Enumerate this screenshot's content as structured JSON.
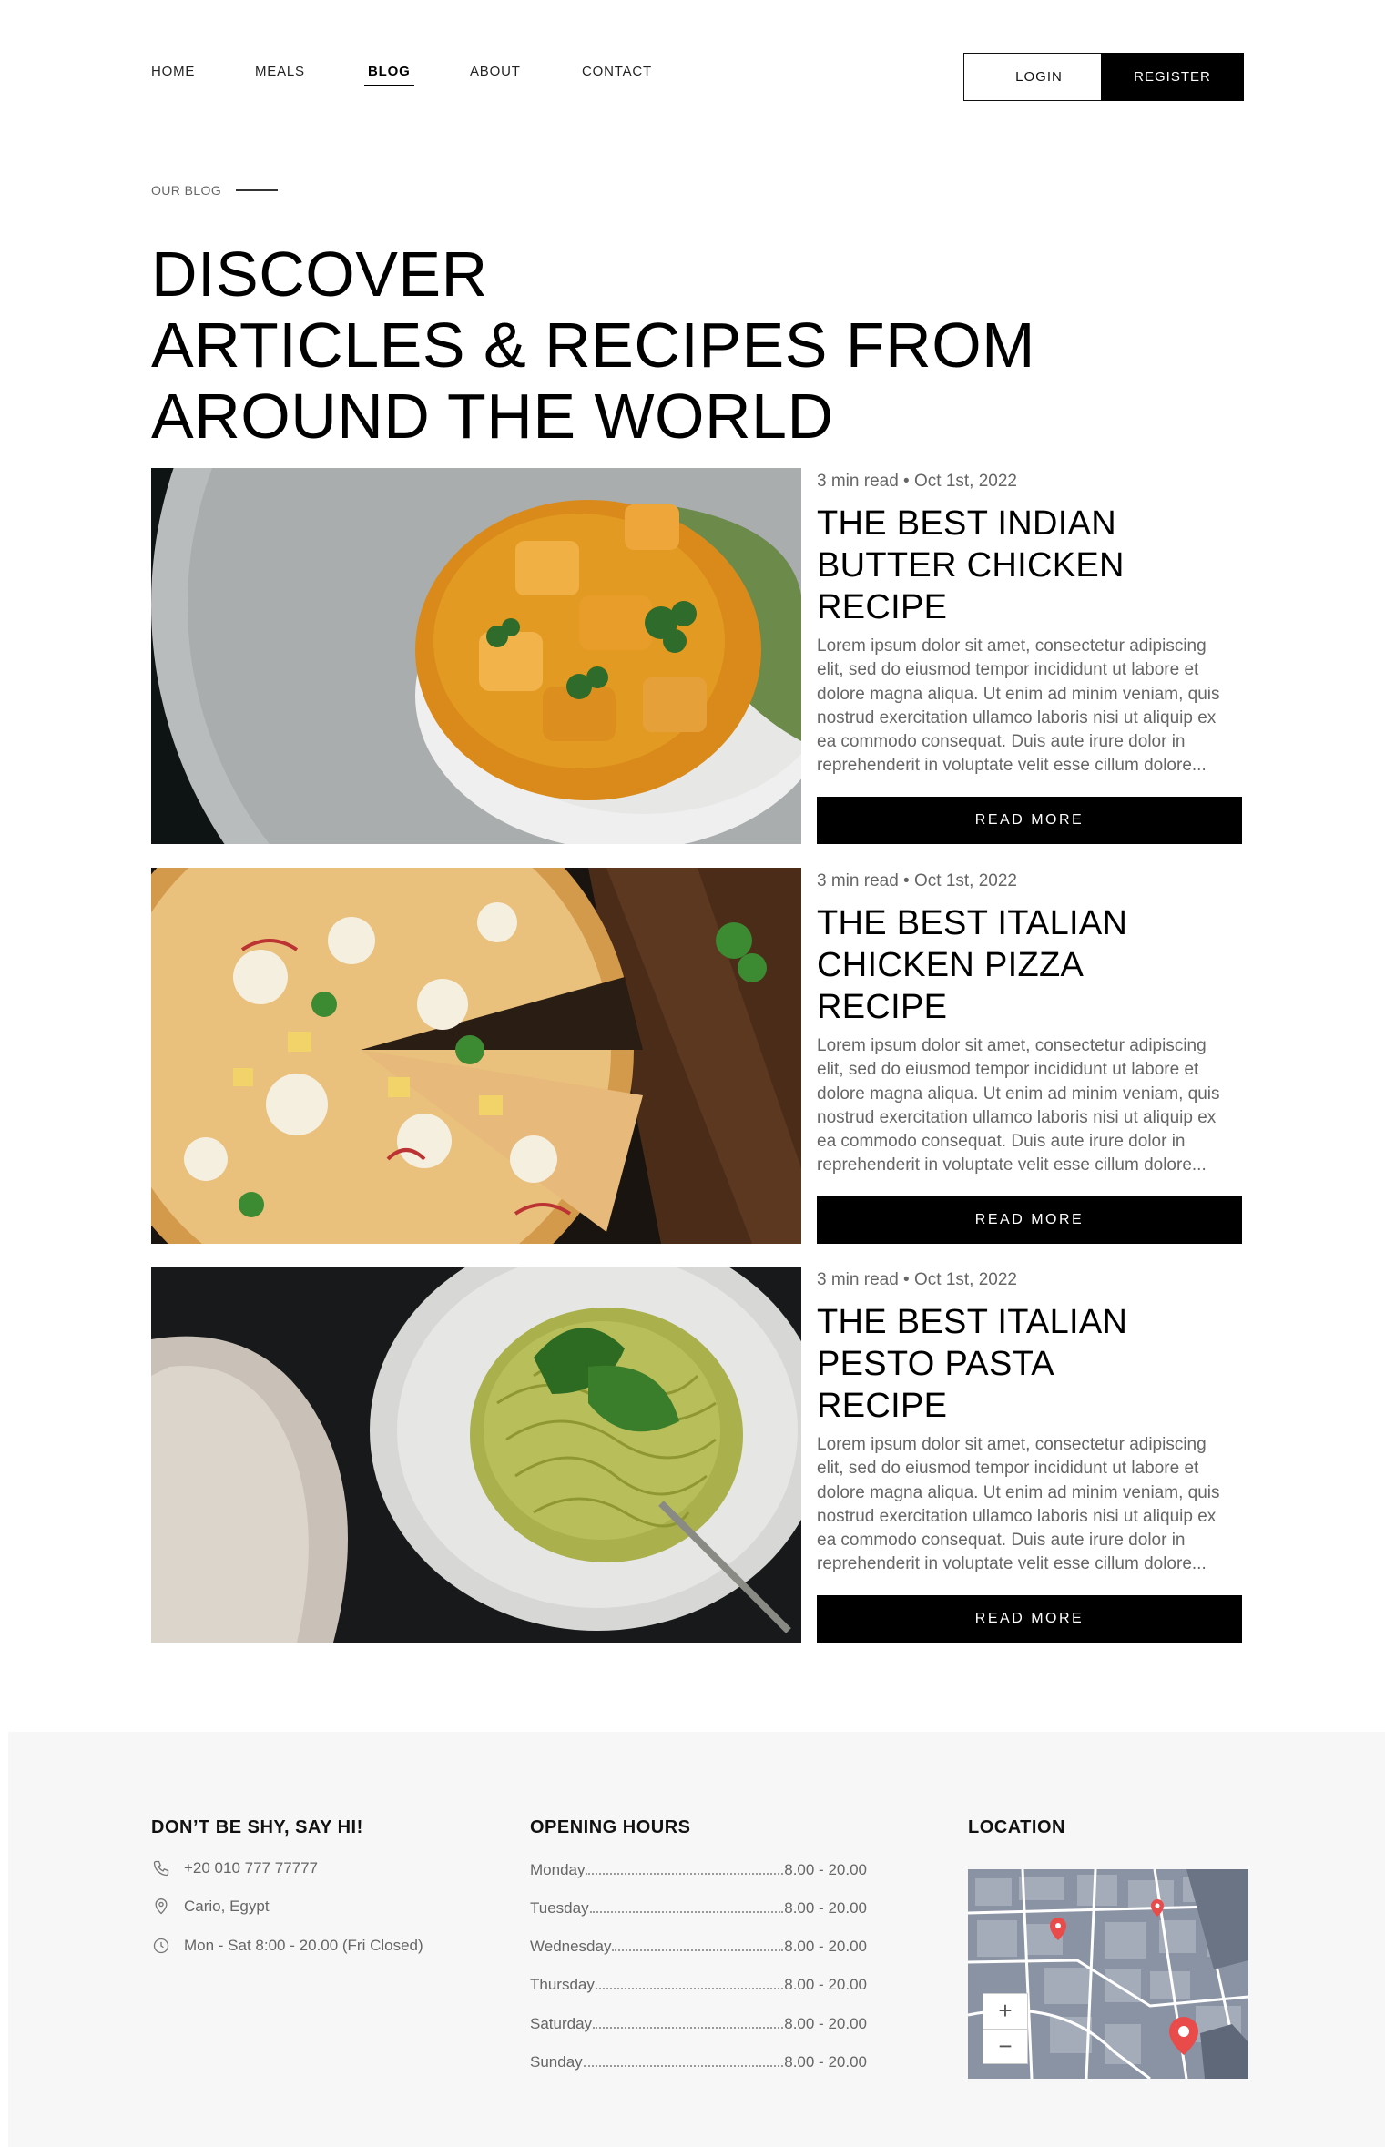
{
  "nav": {
    "items": [
      {
        "label": "HOME"
      },
      {
        "label": "MEALS"
      },
      {
        "label": "BLOG"
      },
      {
        "label": "ABOUT"
      },
      {
        "label": "CONTACT"
      }
    ],
    "active": "BLOG",
    "login_label": "LOGIN",
    "register_label": "REGISTER"
  },
  "hero": {
    "eyebrow": "OUR BLOG",
    "title_line1": "DISCOVER",
    "title_line2": "ARTICLES & RECIPES FROM",
    "title_line3": "AROUND THE WORLD"
  },
  "articles": [
    {
      "meta": "3 min read • Oct 1st, 2022",
      "title_line1": "THE BEST INDIAN",
      "title_line2": "BUTTER CHICKEN",
      "title_line3": "RECIPE",
      "excerpt": "Lorem ipsum dolor sit amet, consectetur adipiscing elit, sed do eiusmod tempor incididunt ut labore et dolore magna aliqua. Ut enim ad minim veniam, quis nostrud exercitation ullamco laboris nisi ut aliquip ex ea commodo consequat. Duis aute irure dolor in reprehenderit in voluptate velit esse cillum dolore...",
      "button": "READ MORE",
      "image": "butter-chicken-photo"
    },
    {
      "meta": "3 min read • Oct 1st, 2022",
      "title_line1": "THE BEST ITALIAN",
      "title_line2": "CHICKEN PIZZA",
      "title_line3": "RECIPE",
      "excerpt": "Lorem ipsum dolor sit amet, consectetur adipiscing elit, sed do eiusmod tempor incididunt ut labore et dolore magna aliqua. Ut enim ad minim veniam, quis nostrud exercitation ullamco laboris nisi ut aliquip ex ea commodo consequat. Duis aute irure dolor in reprehenderit in voluptate velit esse cillum dolore...",
      "button": "READ MORE",
      "image": "chicken-pizza-photo"
    },
    {
      "meta": "3 min read • Oct 1st, 2022",
      "title_line1": "THE BEST ITALIAN",
      "title_line2": "PESTO PASTA",
      "title_line3": "RECIPE",
      "excerpt": "Lorem ipsum dolor sit amet, consectetur adipiscing elit, sed do eiusmod tempor incididunt ut labore et dolore magna aliqua. Ut enim ad minim veniam, quis nostrud exercitation ullamco laboris nisi ut aliquip ex ea commodo consequat. Duis aute irure dolor in reprehenderit in voluptate velit esse cillum dolore...",
      "button": "READ MORE",
      "image": "pesto-pasta-photo"
    }
  ],
  "footer": {
    "contact": {
      "heading": "DON’T BE SHY, SAY HI!",
      "phone": "+20 010 777 77777",
      "address": "Cario, Egypt",
      "hours": "Mon - Sat 8:00 - 20.00 (Fri Closed)"
    },
    "opening": {
      "heading": "OPENING HOURS",
      "rows": [
        {
          "day": "Monday",
          "time": "8.00 - 20.00"
        },
        {
          "day": "Tuesday",
          "time": "8.00 - 20.00"
        },
        {
          "day": "Wednesday",
          "time": "8.00 - 20.00"
        },
        {
          "day": "Thursday",
          "time": "8.00 - 20.00"
        },
        {
          "day": "Saturday",
          "time": "8.00 - 20.00"
        },
        {
          "day": "Sunday",
          "time": "8.00 - 20.00"
        }
      ]
    },
    "location": {
      "heading": "LOCATION",
      "zoom_in": "+",
      "zoom_out": "−"
    }
  },
  "colors": {
    "primary": "#000000",
    "text_muted": "#666666",
    "footer_bg": "#f7f7f7",
    "map_pin": "#e94b4b",
    "map_bg": "#8a93a3"
  }
}
